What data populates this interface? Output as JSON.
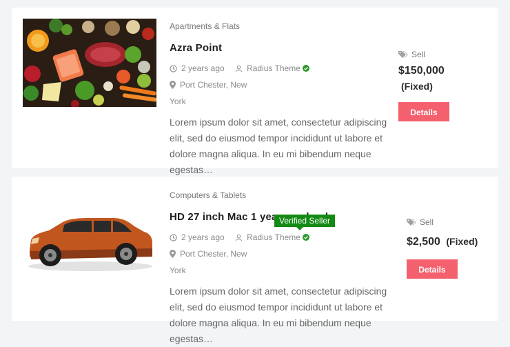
{
  "listings": [
    {
      "category": "Apartments & Flats",
      "title": "Azra Point",
      "time": "2 years ago",
      "author": "Radius Theme",
      "location_line1": "Port Chester, New",
      "location_line2": "York",
      "description": "Lorem ipsum dolor sit amet, consectetur adipiscing elit, sed do eiusmod tempor incididunt ut labore et dolore magna aliqua. In eu mi bibendum neque egestas…",
      "type": "Sell",
      "price": "$150,000",
      "price_note": "(Fixed)",
      "button": "Details",
      "image": "food-photo"
    },
    {
      "category": "Computers & Tablets",
      "title": "HD 27 inch Mac 1 year used only",
      "time": "2 years ago",
      "author": "Radius Theme",
      "location_line1": "Port Chester, New",
      "location_line2": "York",
      "description": "Lorem ipsum dolor sit amet, consectetur adipiscing elit, sed do eiusmod tempor incididunt ut labore et dolore magna aliqua. In eu mi bibendum neque egestas…",
      "type": "Sell",
      "price": "$2,500",
      "price_note": "(Fixed)",
      "button": "Details",
      "image": "orange-car-photo",
      "tooltip": "Verified Seller"
    }
  ],
  "colors": {
    "button": "#f4606d",
    "verified": "#138a13",
    "card": "#ffffff",
    "background": "#f3f4f6"
  },
  "icons": [
    "clock-icon",
    "user-icon",
    "verified-check-icon",
    "map-pin-icon",
    "tag-icon"
  ]
}
